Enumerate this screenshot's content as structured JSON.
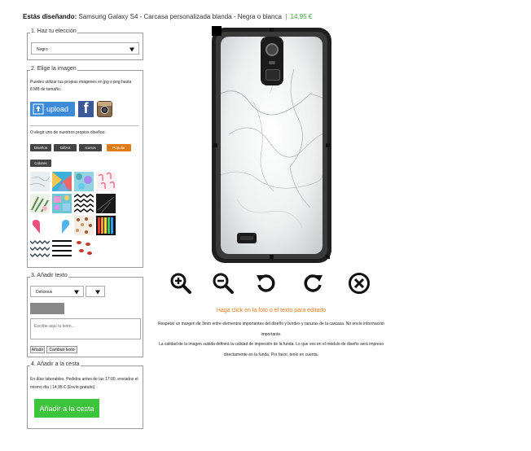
{
  "header": {
    "label": "Estás diseñando:",
    "product": "Samsung Galaxy S4 - Carcasa personalizada blanda - Negra o blanca",
    "separator": "|",
    "price": "14,95 €"
  },
  "step1": {
    "legend": "1. Haz tu elección",
    "select_value": "Negro"
  },
  "step2": {
    "legend": "2. Elige la imagen",
    "instructions": "Puedes utilizar tus propias imágenes en jpg o png hasta 8 MB de tamaño.",
    "upload_label": "upload",
    "facebook_glyph": "f",
    "alt_text": "O elegir uno de nuestros propios diseños:",
    "tabs": [
      "Diseños",
      "GiftArt",
      "Iconos",
      "Popular",
      "Colores"
    ],
    "active_tab": "Popular"
  },
  "step3": {
    "legend": "3. Añadir texto",
    "font_value": "Delicious",
    "size_value": "",
    "text_placeholder": "Escribe aquí tu texto...",
    "add_label": "Añadir",
    "change_label": "Cambiar texto",
    "color_swatch": "#888888"
  },
  "step4": {
    "legend": "4. Añadir a la cesta",
    "shipping_text": "En días laborables. Pedidos antes de las 17:00, enviados el mismo día | 14,95 € (Envío gratuito)",
    "cart_label": "Añadir a la cesta"
  },
  "tools": {
    "zoom_in": "zoom-in-icon",
    "zoom_out": "zoom-out-icon",
    "rotate_left": "rotate-left-icon",
    "rotate_right": "rotate-right-icon",
    "delete": "delete-icon"
  },
  "editor": {
    "hint": "Haga click en la foto o el texto para editarlo",
    "notice1": "Respetar un margen de 3mm entre elementos importantes del diseño y bordes y ranuras de la carcasa. No envíe información importante.",
    "notice2": "La calidad de la imagen subida definirá la calidad de impresión de la funda. Lo que ves en el módulo de diseño será impreso directamente en la funda. Por favor, tenlo en cuenta."
  },
  "colors": {
    "accent": "#e07b19",
    "price": "#3aa53a",
    "cart": "#3cc43c",
    "upload": "#3d8ad6"
  }
}
